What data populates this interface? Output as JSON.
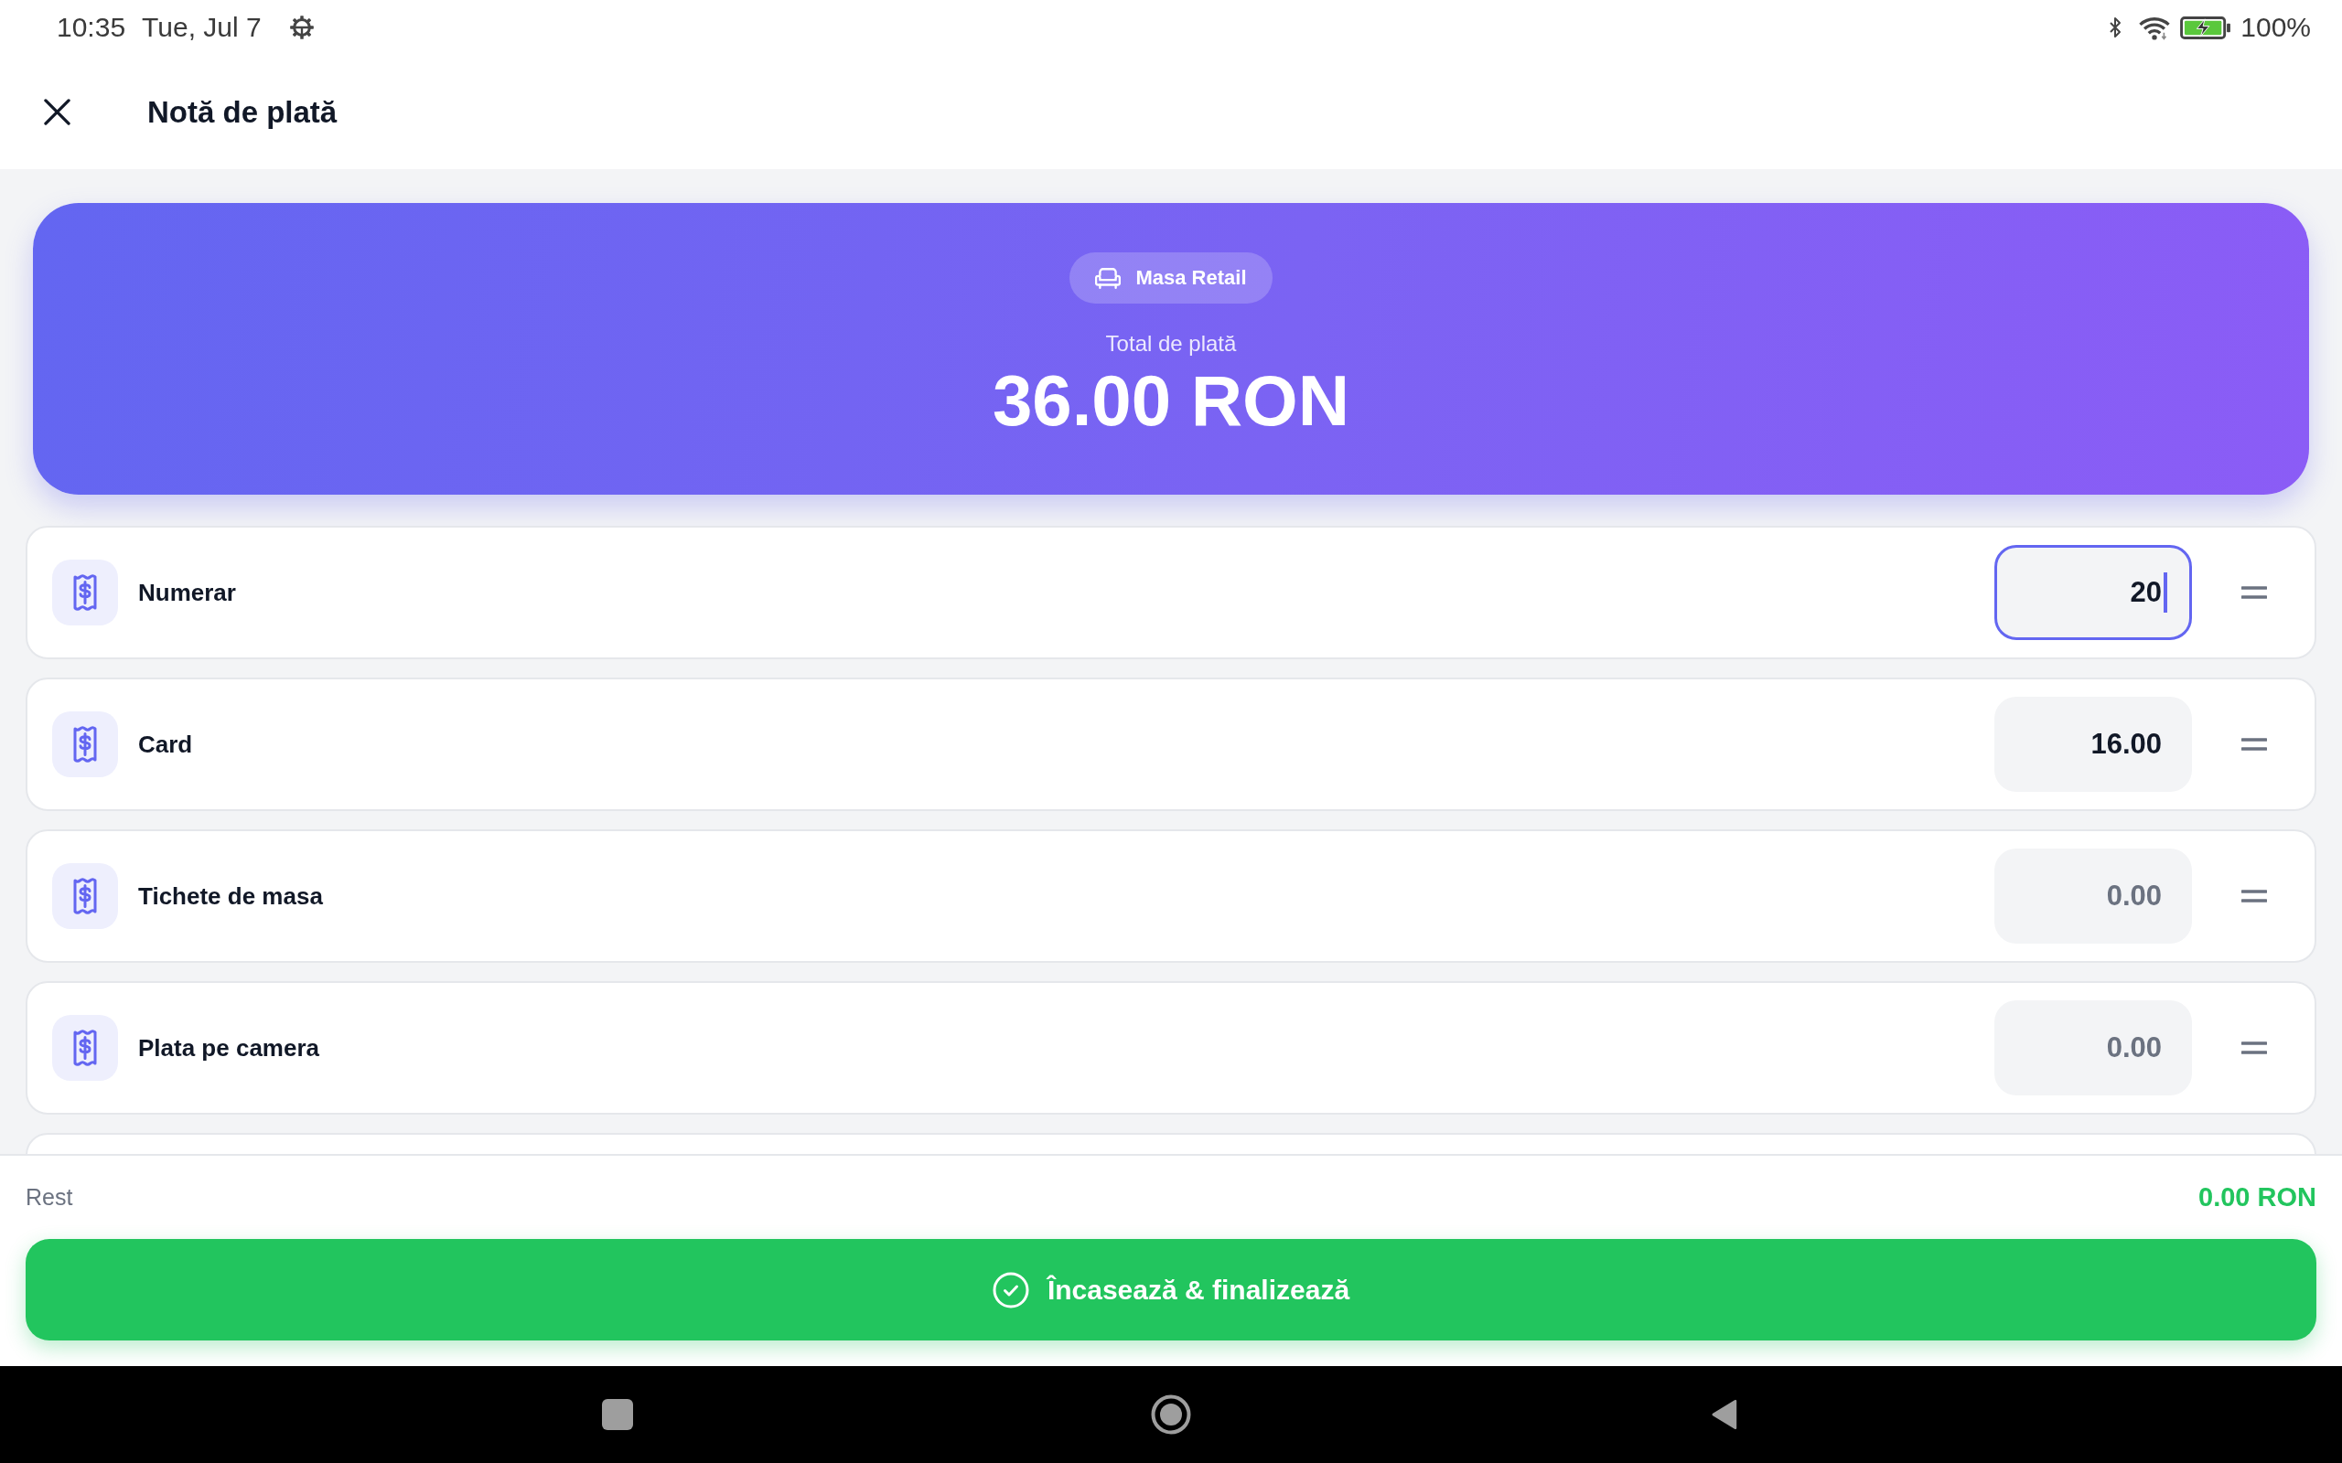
{
  "status_bar": {
    "time": "10:35",
    "date": "Tue, Jul 7",
    "battery": "100%"
  },
  "header": {
    "title": "Notă de plată"
  },
  "summary": {
    "table": "Masa Retail",
    "total_label": "Total de plată",
    "total": "36.00 RON"
  },
  "payment_methods": [
    {
      "label": "Numerar",
      "value": "20",
      "focused": true
    },
    {
      "label": "Card",
      "value": "16.00",
      "focused": false
    },
    {
      "label": "Tichete de masa",
      "placeholder": "0.00",
      "focused": false
    },
    {
      "label": "Plata pe camera",
      "placeholder": "0.00",
      "focused": false
    }
  ],
  "footer": {
    "change_label": "Rest",
    "change": "0.00 RON",
    "button": "Încasează & finalizează"
  }
}
